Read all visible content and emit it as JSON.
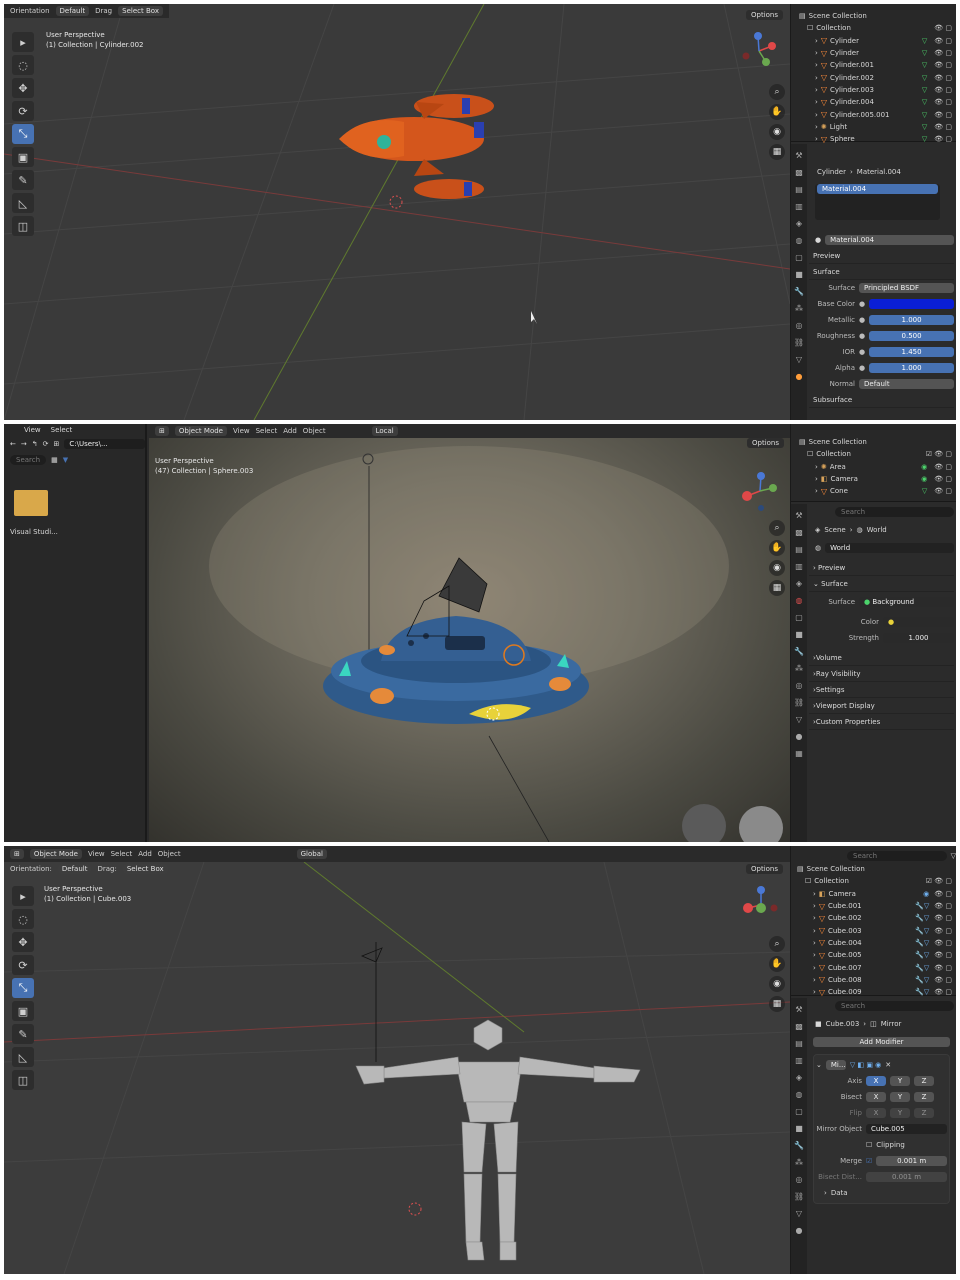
{
  "panel1": {
    "header": {
      "orientation": "Orientation",
      "orientation_value": "Default",
      "drag": "Drag",
      "drag_value": "Select Box",
      "options": "Options"
    },
    "viewport": {
      "info_line1": "User Perspective",
      "info_line2": "(1) Collection | Cylinder.002"
    },
    "outliner": {
      "scene_collection": "Scene Collection",
      "collection": "Collection",
      "items": [
        "Cylinder",
        "Cylinder",
        "Cylinder.001",
        "Cylinder.002",
        "Cylinder.003",
        "Cylinder.004",
        "Cylinder.005.001",
        "Light",
        "Sphere"
      ]
    },
    "properties": {
      "breadcrumb": "Cylinder",
      "breadcrumb2": "Material.004",
      "slot": "Material.004",
      "material": "Material.004",
      "preview": "Preview",
      "surface_section": "Surface",
      "surface_label": "Surface",
      "surface_value": "Principled BSDF",
      "fields": [
        {
          "label": "Base Color",
          "value": ""
        },
        {
          "label": "Metallic",
          "value": "1.000"
        },
        {
          "label": "Roughness",
          "value": "0.500"
        },
        {
          "label": "IOR",
          "value": "1.450"
        },
        {
          "label": "Alpha",
          "value": "1.000"
        }
      ],
      "normal_label": "Normal",
      "normal_value": "Default",
      "subsurface": "Subsurface"
    }
  },
  "panel2": {
    "filebrowser": {
      "menu_view": "View",
      "menu_select": "Select",
      "path": "C:\\Users\\...",
      "search_placeholder": "Search",
      "folder_name": "Visual Studi..."
    },
    "header": {
      "mode": "Object Mode",
      "view": "View",
      "select": "Select",
      "add": "Add",
      "object": "Object",
      "transform": "Local",
      "options": "Options"
    },
    "viewport": {
      "info_line1": "User Perspective",
      "info_line2": "(47) Collection | Sphere.003"
    },
    "outliner": {
      "scene_collection": "Scene Collection",
      "collection": "Collection",
      "items": [
        "Area",
        "Camera",
        "Cone"
      ]
    },
    "properties": {
      "search_placeholder": "Search",
      "breadcrumb_scene": "Scene",
      "breadcrumb_world": "World",
      "world_name": "World",
      "sections": [
        "Preview",
        "Surface"
      ],
      "surface_label": "Surface",
      "surface_value": "Background",
      "color_label": "Color",
      "strength_label": "Strength",
      "strength_value": "1.000",
      "collapsed": [
        "Volume",
        "Ray Visibility",
        "Settings",
        "Viewport Display",
        "Custom Properties"
      ]
    }
  },
  "panel3": {
    "header": {
      "mode": "Object Mode",
      "view": "View",
      "select": "Select",
      "add": "Add",
      "object": "Object",
      "transform": "Global",
      "orientation": "Orientation:",
      "orientation_value": "Default",
      "drag": "Drag:",
      "drag_value": "Select Box",
      "options": "Options"
    },
    "viewport": {
      "info_line1": "User Perspective",
      "info_line2": "(1) Collection | Cube.003"
    },
    "outliner": {
      "search_placeholder": "Search",
      "scene_collection": "Scene Collection",
      "collection": "Collection",
      "items": [
        "Camera",
        "Cube.001",
        "Cube.002",
        "Cube.003",
        "Cube.004",
        "Cube.005",
        "Cube.007",
        "Cube.008",
        "Cube.009"
      ]
    },
    "properties": {
      "search_placeholder": "Search",
      "breadcrumb_object": "Cube.003",
      "breadcrumb_mod": "Mirror",
      "add_modifier": "Add Modifier",
      "modifier_name": "Mi...",
      "axis_label": "Axis",
      "bisect_label": "Bisect",
      "flip_label": "Flip",
      "x": "X",
      "y": "Y",
      "z": "Z",
      "mirror_object_label": "Mirror Object",
      "mirror_object_value": "Cube.005",
      "clipping_label": "Clipping",
      "merge_label": "Merge",
      "merge_value": "0.001 m",
      "bisect_dist_label": "Bisect Dist...",
      "bisect_dist_value": "0.001 m",
      "data_label": "Data"
    }
  },
  "colors": {
    "accent": "#4772b3",
    "rocket": "#d9541b",
    "ufo": "#2f5a8a",
    "figure": "#b8b8b8",
    "base_color_swatch": "#0a1fd6"
  }
}
